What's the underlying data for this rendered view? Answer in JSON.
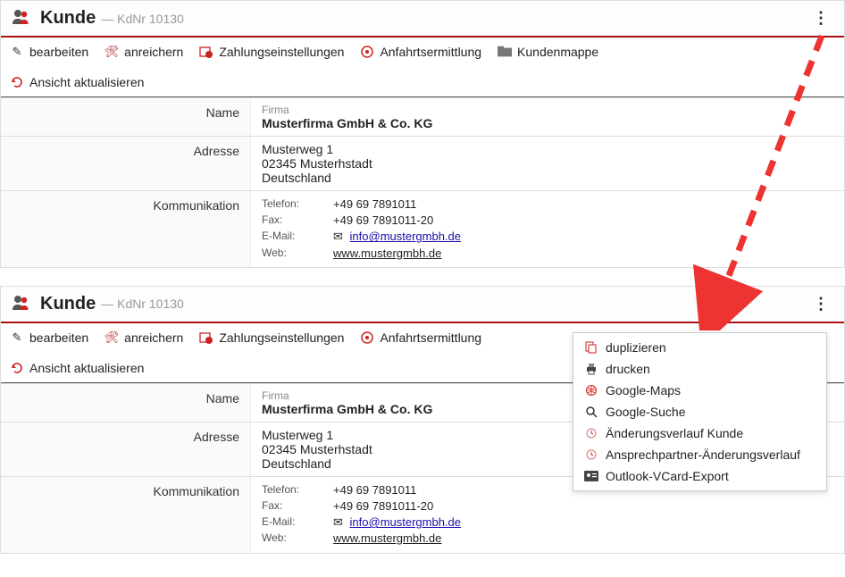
{
  "header": {
    "title": "Kunde",
    "subtitle": "— KdNr 10130"
  },
  "toolbar": {
    "edit": "bearbeiten",
    "enrich": "anreichern",
    "payment": "Zahlungseinstellungen",
    "route": "Anfahrtsermittlung",
    "dossier": "Kundenmappe",
    "refresh": "Ansicht aktualisieren"
  },
  "fields": {
    "name_label": "Name",
    "firm_small": "Firma",
    "firm_value": "Musterfirma GmbH & Co. KG",
    "addr_label": "Adresse",
    "addr_line1": "Musterweg 1",
    "addr_line2": "02345 Musterhstadt",
    "addr_line3": "Deutschland",
    "comm_label": "Kommunikation",
    "tel_label": "Telefon:",
    "tel_val": "+49 69 7891011",
    "fax_label": "Fax:",
    "fax_val": "+49 69 7891011-20",
    "mail_label": "E-Mail:",
    "mail_val": "info@mustergmbh.de",
    "web_label": "Web:",
    "web_val": "www.mustergmbh.de"
  },
  "menu": {
    "duplicate": "duplizieren",
    "print": "drucken",
    "gmaps": "Google-Maps",
    "gsearch": "Google-Suche",
    "history_customer": "Änderungsverlauf Kunde",
    "history_contact": "Ansprechpartner-Änderungsverlauf",
    "vcard": "Outlook-VCard-Export"
  }
}
